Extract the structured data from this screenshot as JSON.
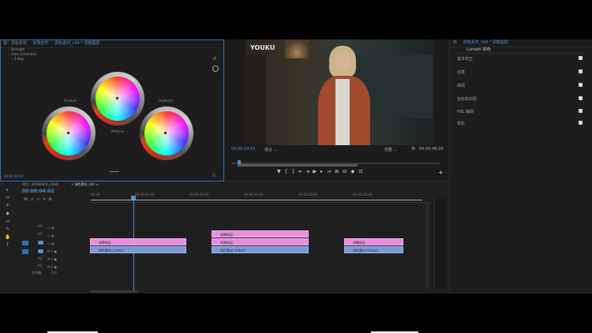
{
  "effect_controls": {
    "tabs": [
      "源：调色素材",
      "效果控件",
      "调色素材_c04 * 调整图层"
    ],
    "rows": [
      "Strength",
      "Color Correction",
      "3-Way"
    ],
    "wheels": [
      {
        "label": "Shadow"
      },
      {
        "label": "Midtone"
      },
      {
        "label": "Highlight"
      }
    ],
    "timecode": "00:00:04:02"
  },
  "program_monitor": {
    "watermark": "YOUKU",
    "current_time": "00:00:04:02",
    "fit": "适合",
    "quality": "完整",
    "duration": "00:00:46:20"
  },
  "lumetri": {
    "tabs": [
      "库",
      "调色素材_c04 * 调整图层"
    ],
    "dropdown": "Lumetri 颜色",
    "sections": [
      "基本校正",
      "创意",
      "曲线",
      "色轮和匹配",
      "HSL 辅助",
      "晕影"
    ]
  },
  "project": {
    "tab": "项目：20190924_c4a92",
    "timeline_tab": "调色素材_c04"
  },
  "timeline": {
    "timecode": "00:00:04:02",
    "ruler": [
      "00:00",
      "00:00:05:00",
      "00:00:10:00",
      "00:00:15:00",
      "00:00:20:00",
      "00:00:25:00"
    ],
    "tracks_video": [
      "V3",
      "V2",
      "V1"
    ],
    "tracks_audio": [
      "A1",
      "A2",
      "A3"
    ],
    "master": "主声道",
    "master_value": "0.0",
    "clips": [
      {
        "label": "调整图层",
        "kind": "adj"
      },
      {
        "label": "调整图层",
        "kind": "adj"
      },
      {
        "label": "调整图层",
        "kind": "adj"
      },
      {
        "label": "调整图层",
        "kind": "adj"
      },
      {
        "label": "调色素材_[video]",
        "kind": "vid"
      },
      {
        "label": "调色素材 [Video]",
        "kind": "vid"
      },
      {
        "label": "调色素材 [Video]",
        "kind": "vid"
      }
    ]
  }
}
